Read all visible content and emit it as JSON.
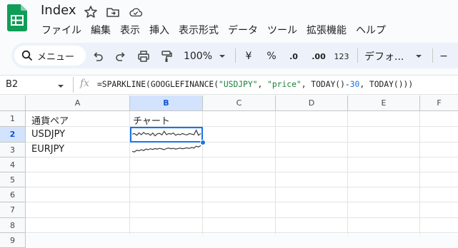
{
  "doc": {
    "title": "Index"
  },
  "menu": [
    "ファイル",
    "編集",
    "表示",
    "挿入",
    "表示形式",
    "データ",
    "ツール",
    "拡張機能",
    "ヘルプ"
  ],
  "toolbar": {
    "search_label": "メニュー",
    "zoom": "100%",
    "currency": "¥",
    "percent": "%",
    "dec_decrease": ".0",
    "dec_increase": ".00",
    "number_format": "123",
    "font": "デフォ...",
    "minus": "−"
  },
  "formula_bar": {
    "cell_ref": "B2",
    "fx": "fx",
    "formula": {
      "p1": "=SPARKLINE(GOOGLEFINANCE(",
      "s1": "\"USDJPY\"",
      "p2": ", ",
      "s2": "\"price\"",
      "p3": ", TODAY()-",
      "n1": "30",
      "p4": ", TODAY()))"
    }
  },
  "grid": {
    "columns": [
      "A",
      "B",
      "C",
      "D",
      "E",
      "F"
    ],
    "rows": [
      "1",
      "2",
      "3",
      "4",
      "5",
      "6",
      "7",
      "8",
      "9"
    ],
    "selected_cell": "B2",
    "cells": {
      "A1": "通貨ペア",
      "B1": "チャート",
      "A2": "USDJPY",
      "A3": "EURJPY"
    },
    "sparklines": {
      "B2": [
        0.45,
        0.4,
        0.55,
        0.35,
        0.5,
        0.3,
        0.45,
        0.4,
        0.55,
        0.35,
        0.6,
        0.42,
        0.38,
        0.52,
        0.2,
        0.5,
        0.4,
        0.45,
        0.35,
        0.55,
        0.45,
        0.5,
        0.4,
        0.48,
        0.52,
        0.4,
        0.45,
        0.5,
        0.1,
        0.55,
        0.4
      ],
      "B3": [
        0.65,
        0.7,
        0.55,
        0.6,
        0.5,
        0.58,
        0.45,
        0.5,
        0.42,
        0.48,
        0.4,
        0.45,
        0.38,
        0.44,
        0.5,
        0.4,
        0.36,
        0.42,
        0.38,
        0.45,
        0.4,
        0.36,
        0.42,
        0.38,
        0.34,
        0.4,
        0.3,
        0.36,
        0.2,
        0.26,
        0.15
      ]
    }
  },
  "colors": {
    "accent": "#1a73e8",
    "selected_header": "#d3e3fd",
    "toolbar_bg": "#edf2fa"
  }
}
